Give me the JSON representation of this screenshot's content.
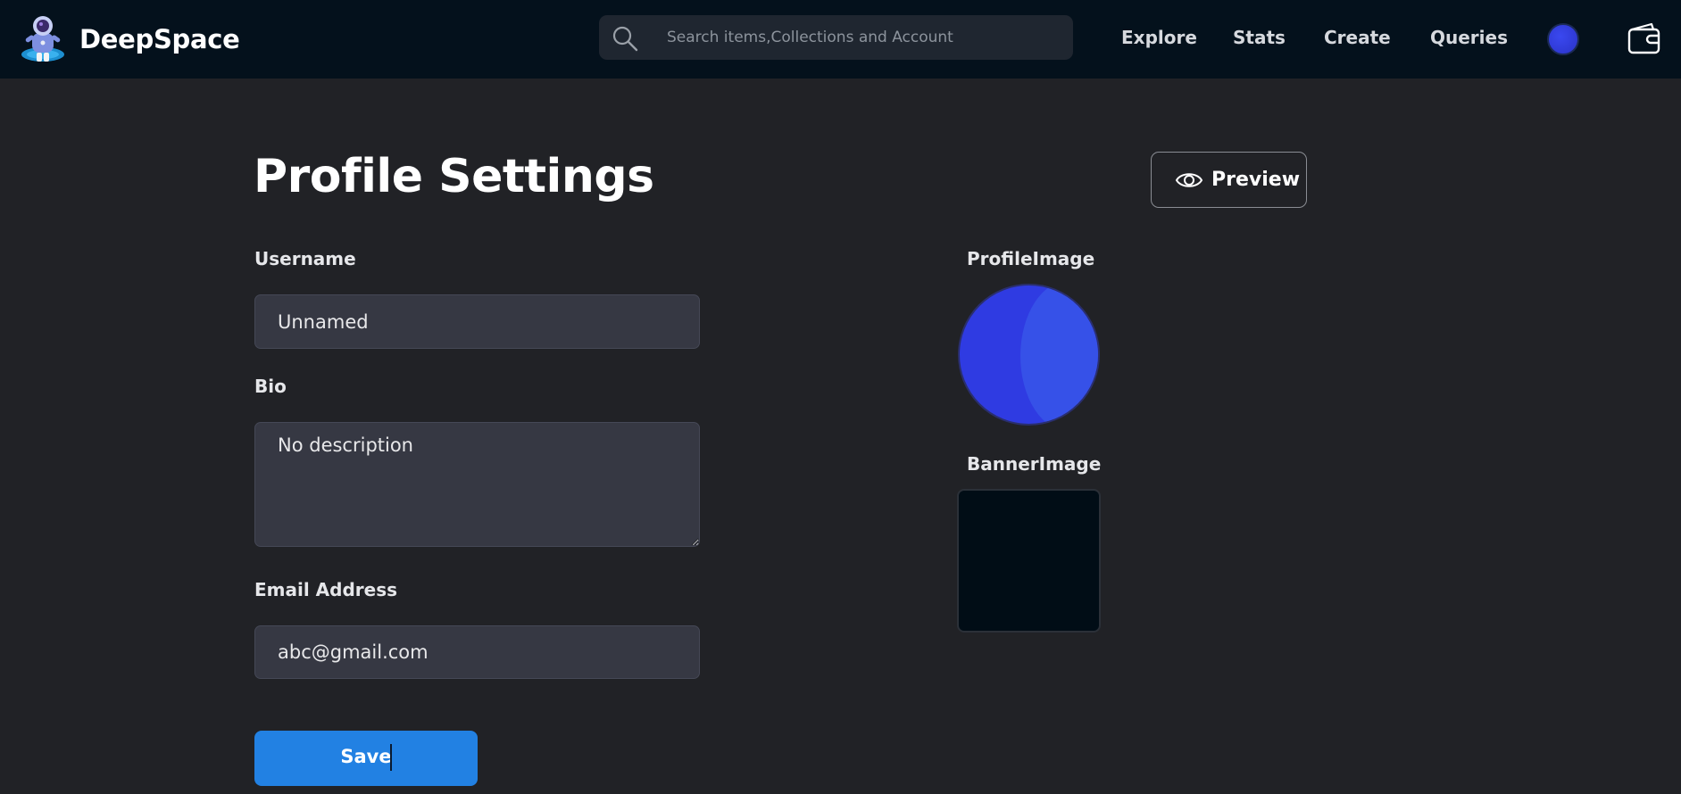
{
  "brand": {
    "name": "DeepSpace",
    "logo_icon": "astronaut-logo-icon"
  },
  "search": {
    "placeholder": "Search items,Collections and Account",
    "value": ""
  },
  "nav": {
    "links": [
      "Explore",
      "Stats",
      "Create",
      "Queries"
    ],
    "wallet_icon": "wallet-icon"
  },
  "page": {
    "title": "Profile Settings",
    "preview_label": "Preview"
  },
  "form": {
    "username": {
      "label": "Username",
      "value": "Unnamed"
    },
    "bio": {
      "label": "Bio",
      "value": "No description"
    },
    "email": {
      "label": "Email Address",
      "value": "abc@gmail.com"
    },
    "save_label": "Save"
  },
  "images": {
    "profile_label": "ProfileImage",
    "banner_label": "BannerImage"
  },
  "colors": {
    "background": "#212226",
    "navbar": "#04111c",
    "accent": "#2281e3",
    "input_bg": "#363843",
    "avatar": "#2f3be2"
  }
}
